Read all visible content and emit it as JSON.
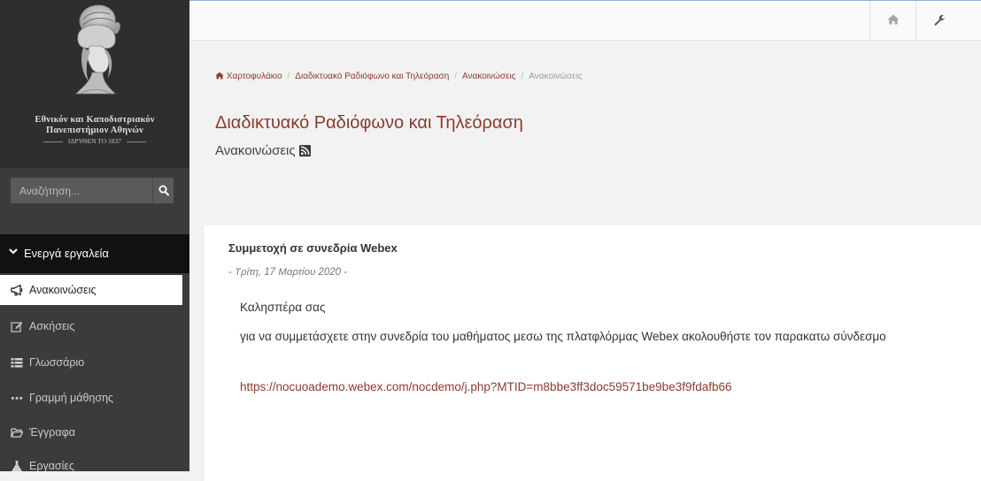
{
  "brand": {
    "university_line1": "Εθνικόν και Καποδιστριακόν",
    "university_line2": "Πανεπιστήμιον Αθηνών",
    "university_line3": "ΙΔΡΥΘΕΝ ΤΟ 1837"
  },
  "search": {
    "placeholder": "Αναζήτηση..."
  },
  "sidebar": {
    "section_label": "Ενεργά εργαλεία",
    "items": [
      {
        "label": "Ανακοινώσεις",
        "icon": "bullhorn-icon"
      },
      {
        "label": "Ασκήσεις",
        "icon": "edit-icon"
      },
      {
        "label": "Γλωσσάριο",
        "icon": "list-icon"
      },
      {
        "label": "Γραμμή μάθησης",
        "icon": "ellipsis-icon"
      },
      {
        "label": "Έγγραφα",
        "icon": "folder-open-icon"
      },
      {
        "label": "Εργασίες",
        "icon": "flask-icon"
      }
    ]
  },
  "topbar": {
    "home_icon": "home-icon",
    "tools_icon": "wrench-icon"
  },
  "breadcrumb": {
    "items": [
      "Χαρτοφυλάκιο",
      "Διαδικτυακό Ραδιόφωνο και Τηλεόραση",
      "Ανακοινώσεις"
    ],
    "current": "Ανακοινώσεις"
  },
  "page": {
    "title": "Διαδικτυακό Ραδιόφωνο και Τηλεόραση",
    "subtitle": "Ανακοινώσεις"
  },
  "announcement": {
    "title": "Συμμετοχή σε συνεδρία Webex",
    "date": "- Τρίτη, 17 Μαρτίου 2020 -",
    "greeting": "Καλησπέρα σας",
    "body": "για να συμμετάσχετε στην συνεδρία του μαθήματος μεσω της πλατφλόρμας Webex ακολουθήστε τον παρακατω σύνδεσμο",
    "link": "https://nocuoademo.webex.com/nocdemo/j.php?MTID=m8bbe3ff3doc59571be9be3f9fdafb66"
  },
  "colors": {
    "accent": "#8c3a2e",
    "sidebar_bg": "#3b3b3b",
    "sidebar_header_bg": "#111111"
  }
}
